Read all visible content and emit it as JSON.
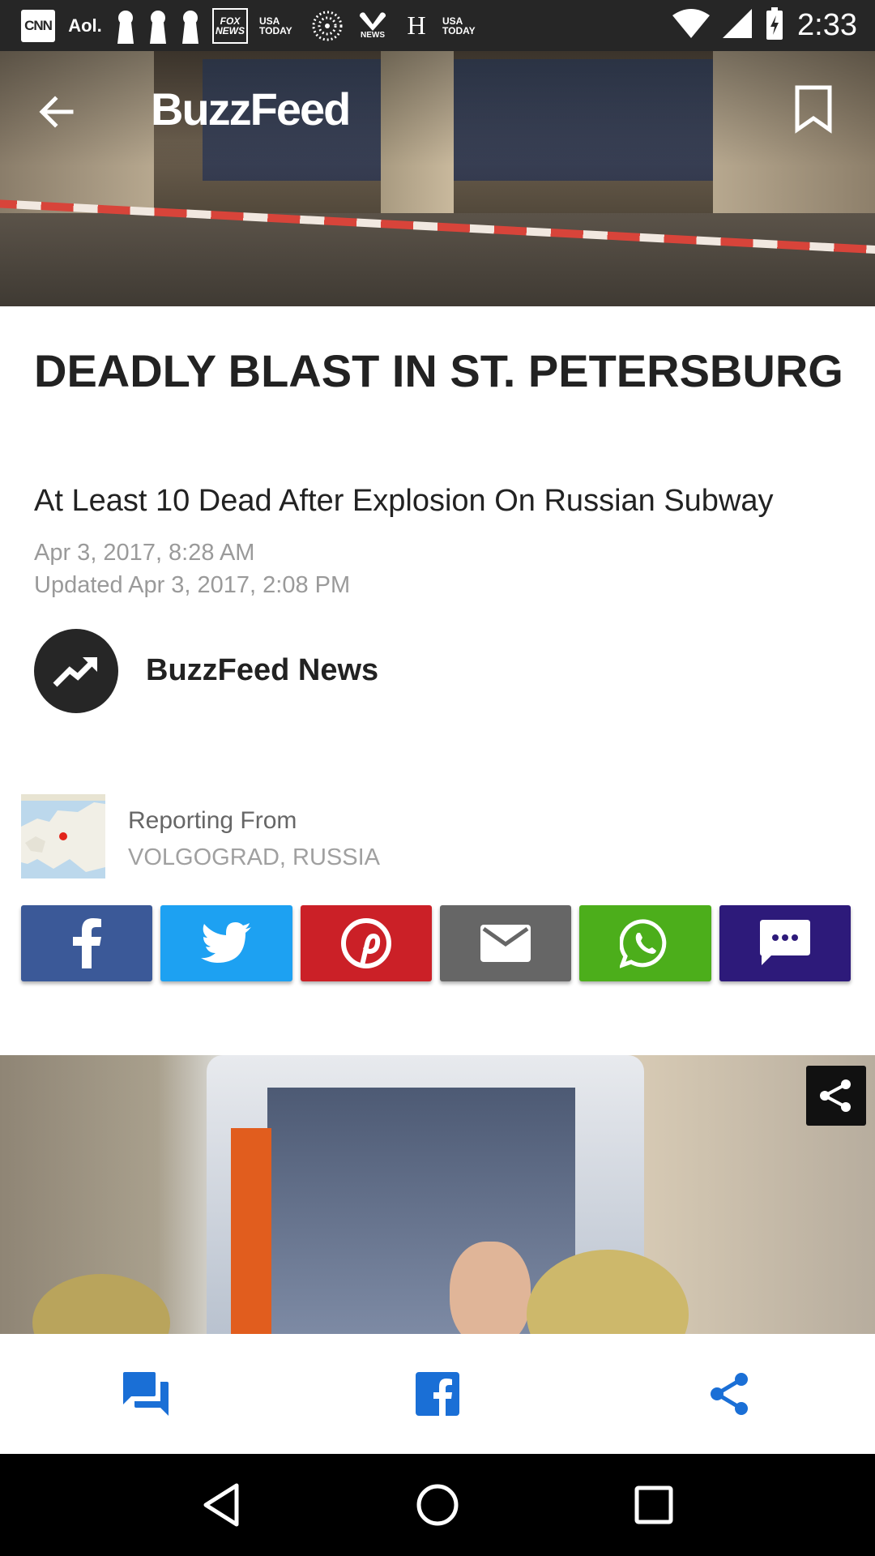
{
  "status_bar": {
    "time": "2:33",
    "notification_icons": [
      "CNN",
      "Aol.",
      "H"
    ],
    "fox_label": "FOX NEWS",
    "usa_today_label": "USA TODAY",
    "nbc_label": "NEWS"
  },
  "app": {
    "logo": "BuzzFeed"
  },
  "article": {
    "headline": "DEADLY BLAST IN ST. PETERSBURG",
    "subheadline": "At Least 10 Dead After Explosion On Russian Subway",
    "published": "Apr 3, 2017, 8:28 AM",
    "updated": "Updated Apr 3, 2017, 2:08 PM",
    "author": "BuzzFeed News",
    "reporting_label": "Reporting From",
    "reporting_place": "VOLGOGRAD, RUSSIA"
  },
  "share_buttons": [
    {
      "name": "facebook",
      "color": "#3b5998"
    },
    {
      "name": "twitter",
      "color": "#1da1f2"
    },
    {
      "name": "pinterest",
      "color": "#cb2027"
    },
    {
      "name": "email",
      "color": "#666666"
    },
    {
      "name": "whatsapp",
      "color": "#4cae1b"
    },
    {
      "name": "sms",
      "color": "#2d1a7a"
    }
  ],
  "toolbar": {
    "icons": [
      "comments-icon",
      "facebook-icon",
      "share-icon"
    ],
    "accent": "#1a6fd6"
  },
  "navigation": {
    "icons": [
      "back-icon",
      "home-icon",
      "recents-icon"
    ]
  }
}
